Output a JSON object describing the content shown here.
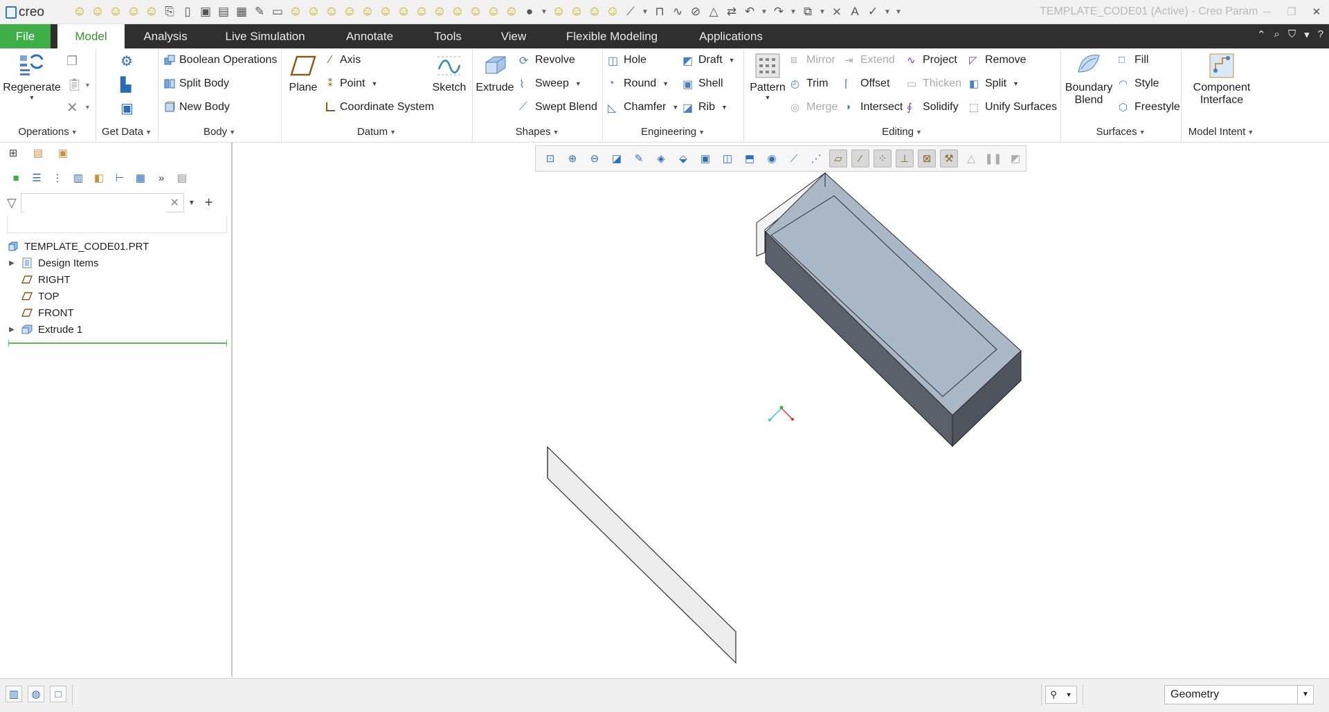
{
  "app": {
    "logo_text": "creo",
    "window_title": "TEMPLATE_CODE01 (Active) - Creo Param",
    "brand_color": "#3fae49"
  },
  "tabs": {
    "file": "File",
    "items": [
      "Model",
      "Analysis",
      "Live Simulation",
      "Annotate",
      "Tools",
      "View",
      "Flexible Modeling",
      "Applications"
    ],
    "active": "Model"
  },
  "ribbon": {
    "operations": {
      "regenerate": "Regenerate",
      "label": "Operations"
    },
    "get_data": {
      "label": "Get Data"
    },
    "body": {
      "boolean": "Boolean Operations",
      "split_body": "Split Body",
      "new_body": "New Body",
      "label": "Body"
    },
    "datum": {
      "plane": "Plane",
      "axis": "Axis",
      "point": "Point",
      "csys": "Coordinate System",
      "sketch": "Sketch",
      "label": "Datum"
    },
    "shapes": {
      "extrude": "Extrude",
      "revolve": "Revolve",
      "sweep": "Sweep",
      "swept_blend": "Swept Blend",
      "label": "Shapes"
    },
    "engineering": {
      "hole": "Hole",
      "round": "Round",
      "chamfer": "Chamfer",
      "draft": "Draft",
      "shell": "Shell",
      "rib": "Rib",
      "label": "Engineering"
    },
    "editing": {
      "pattern": "Pattern",
      "mirror": "Mirror",
      "trim": "Trim",
      "merge": "Merge",
      "extend": "Extend",
      "offset": "Offset",
      "intersect": "Intersect",
      "project": "Project",
      "thicken": "Thicken",
      "solidify": "Solidify",
      "remove": "Remove",
      "split": "Split",
      "unify": "Unify Surfaces",
      "label": "Editing"
    },
    "surfaces": {
      "boundary_1": "Boundary",
      "boundary_2": "Blend",
      "fill": "Fill",
      "style": "Style",
      "freestyle": "Freestyle",
      "label": "Surfaces"
    },
    "model_intent": {
      "component_1": "Component",
      "component_2": "Interface",
      "label": "Model Intent"
    }
  },
  "model_tree": {
    "search_value": "",
    "items": [
      {
        "label": "TEMPLATE_CODE01.PRT",
        "icon": "part-icon",
        "expander": false
      },
      {
        "label": "Design Items",
        "icon": "design-items-icon",
        "expander": true
      },
      {
        "label": "RIGHT",
        "icon": "datum-plane-icon",
        "expander": false
      },
      {
        "label": "TOP",
        "icon": "datum-plane-icon",
        "expander": false
      },
      {
        "label": "FRONT",
        "icon": "datum-plane-icon",
        "expander": false
      },
      {
        "label": "Extrude 1",
        "icon": "extrude-icon",
        "expander": true
      }
    ]
  },
  "status_bar": {
    "selection_filter": "Geometry"
  }
}
